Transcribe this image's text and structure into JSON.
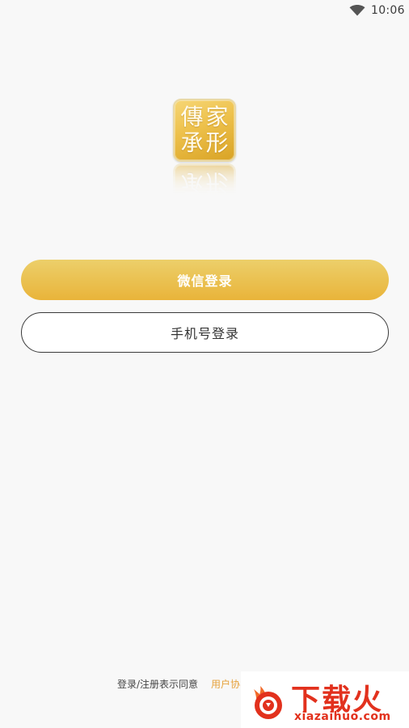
{
  "status_bar": {
    "time": "10:06",
    "wifi_icon": "wifi-icon"
  },
  "logo": {
    "chars": [
      "傳",
      "家",
      "承",
      "形"
    ],
    "colors": {
      "gold_top": "#f6d675",
      "gold_bottom": "#d9a325"
    }
  },
  "actions": {
    "wechat_login_label": "微信登录",
    "phone_login_label": "手机号登录",
    "accent_color": "#e9b43a"
  },
  "footer": {
    "agreement_text": "登录/注册表示同意",
    "agreement_link": "用户协"
  },
  "watermark": {
    "title": "下载火",
    "url": "xiazaihuo.com",
    "color": "#e2311d"
  }
}
